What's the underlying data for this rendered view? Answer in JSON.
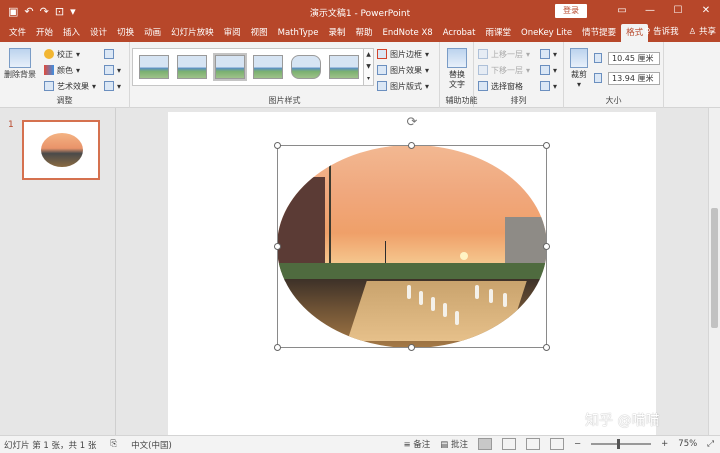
{
  "titlebar": {
    "title": "演示文稿1  -  PowerPoint",
    "login": "登录",
    "qat_icons": [
      "save-icon",
      "undo-icon",
      "redo-icon",
      "start-from-beginning-icon",
      "customize-qat-icon"
    ],
    "window_controls": [
      "ribbon-display-icon",
      "minimize-icon",
      "maximize-icon",
      "close-icon"
    ]
  },
  "tabs": [
    {
      "label": "文件"
    },
    {
      "label": "开始"
    },
    {
      "label": "插入"
    },
    {
      "label": "设计"
    },
    {
      "label": "切换"
    },
    {
      "label": "动画"
    },
    {
      "label": "幻灯片放映"
    },
    {
      "label": "审阅"
    },
    {
      "label": "视图"
    },
    {
      "label": "MathType"
    },
    {
      "label": "录制"
    },
    {
      "label": "帮助"
    },
    {
      "label": "EndNote X8"
    },
    {
      "label": "Acrobat"
    },
    {
      "label": "雨课堂"
    },
    {
      "label": "OneKey Lite"
    },
    {
      "label": "情节提要"
    },
    {
      "label": "格式"
    }
  ],
  "tab_right": {
    "tell_me": "告诉我",
    "share": "共享"
  },
  "ribbon": {
    "adjust": {
      "remove_bg": "删除背景",
      "corrections": "校正",
      "color": "颜色",
      "artistic": "艺术效果",
      "label": "调整"
    },
    "picture_styles": {
      "border": "图片边框",
      "effects": "图片效果",
      "layout": "图片版式",
      "label": "图片样式"
    },
    "accessibility": {
      "alt_text_line1": "替换",
      "alt_text_line2": "文字",
      "label": "辅助功能"
    },
    "arrange": {
      "bring_forward": "上移一层",
      "send_backward": "下移一层",
      "selection_pane": "选择窗格",
      "label": "排列"
    },
    "size": {
      "crop": "裁剪",
      "height": "10.45 厘米",
      "width": "13.94 厘米",
      "label": "大小"
    }
  },
  "thumbnail": {
    "slide_number": "1"
  },
  "watermark": "知乎 @喵喵",
  "status": {
    "slide_info": "幻灯片 第 1 张，共 1 张",
    "language": "中文(中国)",
    "notes": "备注",
    "comments": "批注",
    "zoom": "75%"
  }
}
